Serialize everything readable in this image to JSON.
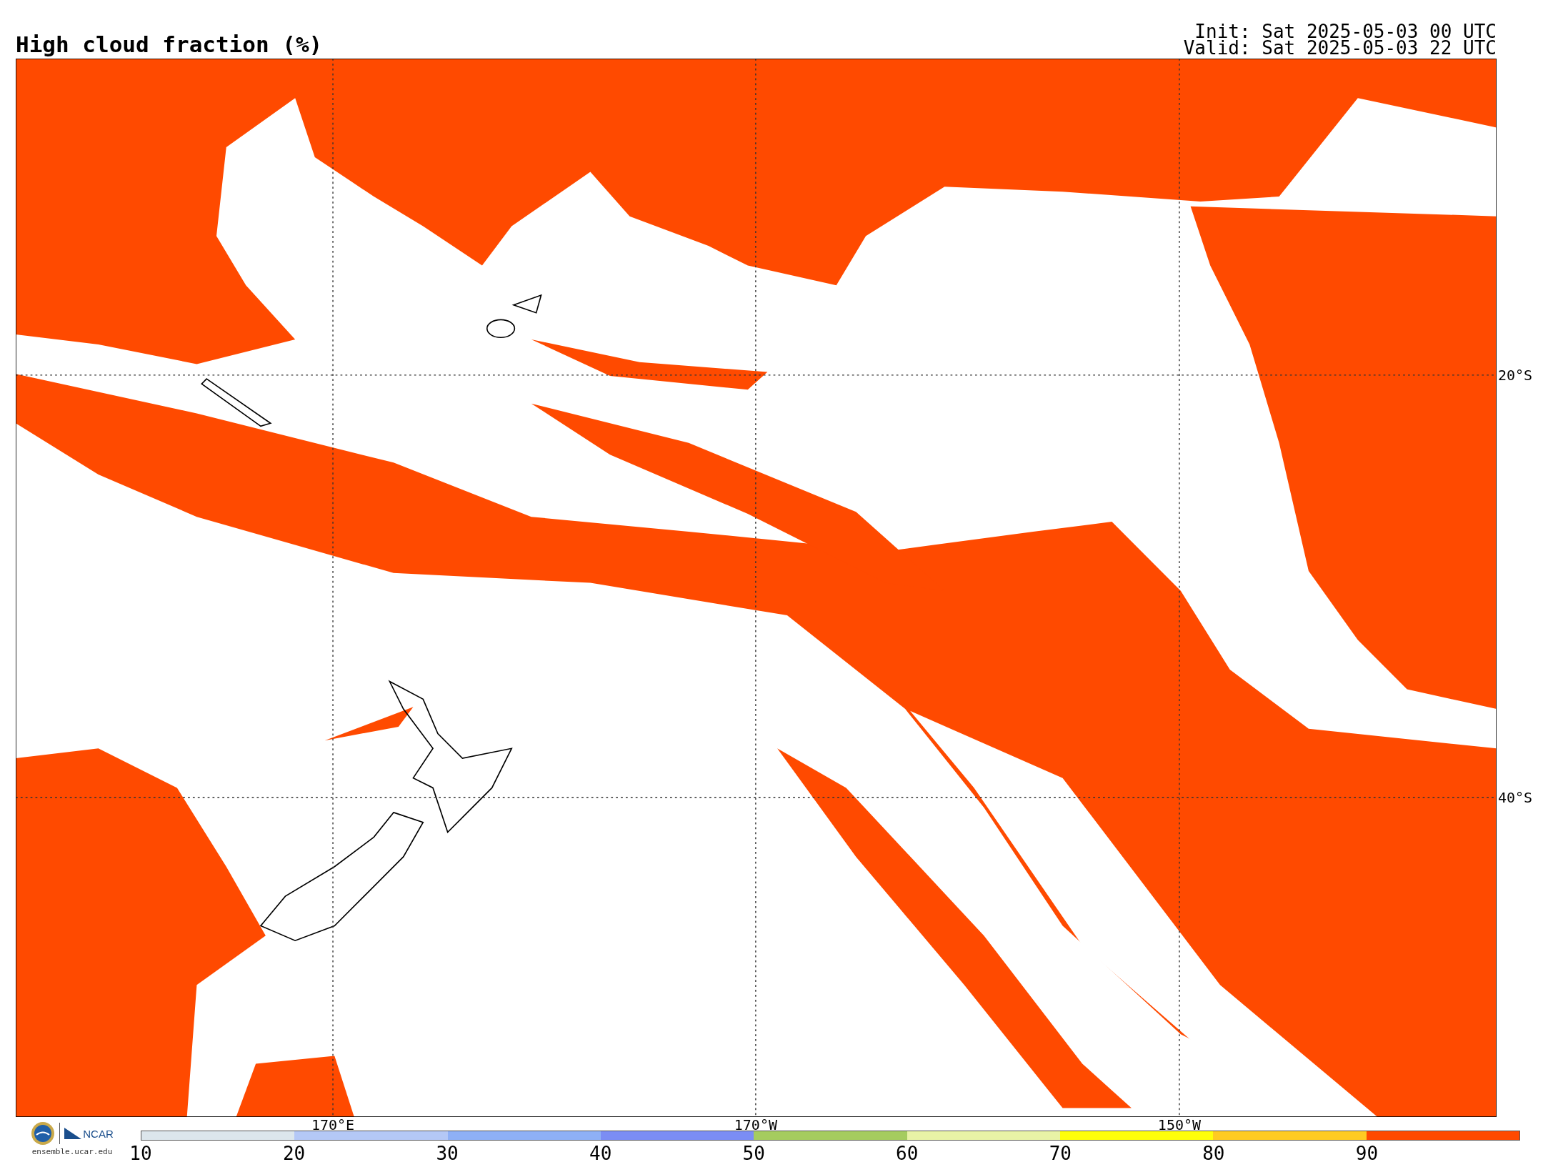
{
  "title": "High cloud fraction (%)",
  "init": "Init: Sat 2025-05-03 00 UTC",
  "valid": "Valid: Sat 2025-05-03 22 UTC",
  "map": {
    "longitude_labels": [
      "170°E",
      "170°W",
      "150°W"
    ],
    "latitude_labels": [
      "20°S",
      "40°S"
    ]
  },
  "logo": {
    "name": "NCAR",
    "url": "ensemble.ucar.edu"
  },
  "colorbar": {
    "segments": [
      {
        "color": "#dce6ec"
      },
      {
        "color": "#b4c8f6"
      },
      {
        "color": "#8eb0f6"
      },
      {
        "color": "#7b8df4"
      },
      {
        "color": "#a5cc5f"
      },
      {
        "color": "#e8f3a6"
      },
      {
        "color": "#ffff0a"
      },
      {
        "color": "#ffcb22"
      },
      {
        "color": "#ff4a00"
      }
    ],
    "tick_labels": [
      "10",
      "20",
      "30",
      "40",
      "50",
      "60",
      "70",
      "80",
      "90"
    ]
  }
}
